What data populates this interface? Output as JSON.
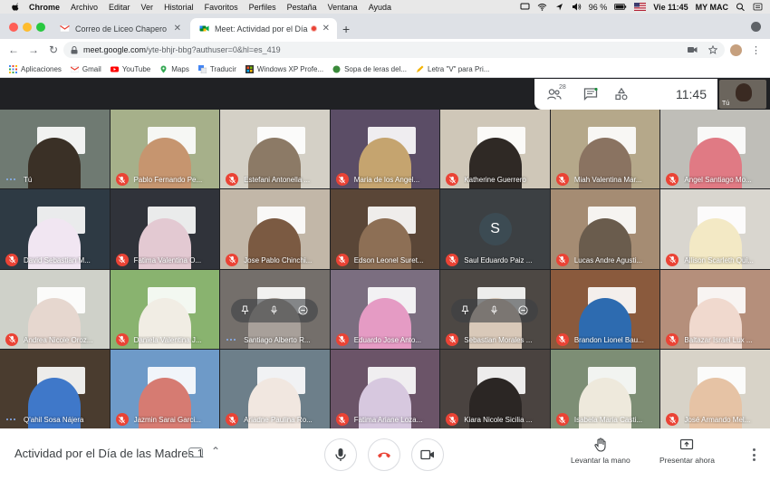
{
  "menubar": {
    "app": "Chrome",
    "items": [
      "Archivo",
      "Editar",
      "Ver",
      "Historial",
      "Favoritos",
      "Perfiles",
      "Pestaña",
      "Ventana",
      "Ayuda"
    ],
    "battery": "96 %",
    "clock": "Vie 11:45",
    "user": "MY MAC"
  },
  "tabs": [
    {
      "title": "Correo de Liceo Chapero",
      "icon": "gmail-icon",
      "active": false
    },
    {
      "title": "Meet: Actividad por el Día",
      "icon": "meet-icon",
      "active": true
    }
  ],
  "toolbar": {
    "url_host": "meet.google.com",
    "url_path": "/yte-bhjr-bbg?authuser=0&hl=es_419"
  },
  "bookmarks": [
    {
      "label": "Aplicaciones",
      "icon": "apps-grid-icon"
    },
    {
      "label": "Gmail",
      "icon": "gmail-icon"
    },
    {
      "label": "YouTube",
      "icon": "youtube-icon"
    },
    {
      "label": "Maps",
      "icon": "maps-icon"
    },
    {
      "label": "Traducir",
      "icon": "translate-icon"
    },
    {
      "label": "Windows XP Profe...",
      "icon": "windows-icon"
    },
    {
      "label": "Sopa de leras del...",
      "icon": "globe-icon"
    },
    {
      "label": "Letra \"V\" para Pri...",
      "icon": "pencil-icon"
    }
  ],
  "meet_topbar": {
    "participant_count": "28",
    "clock": "11:45",
    "self_label": "Tú"
  },
  "participants": [
    {
      "name": "Tú",
      "muted": false,
      "speaking": true,
      "colors": [
        "#6f7a72",
        "#3a3026"
      ]
    },
    {
      "name": "Pablo Fernando Pe...",
      "muted": true,
      "colors": [
        "#a6b08a",
        "#c6956f"
      ]
    },
    {
      "name": "Estefani Antonella ...",
      "muted": true,
      "colors": [
        "#d4d0c6",
        "#8c7a66"
      ]
    },
    {
      "name": "Maria de los Angel...",
      "muted": true,
      "colors": [
        "#5b4d66",
        "#c5a46f"
      ]
    },
    {
      "name": "Katherine Guerrero",
      "muted": true,
      "colors": [
        "#cfc7b8",
        "#2f2925"
      ]
    },
    {
      "name": "Miah Valentina Mar...",
      "muted": true,
      "colors": [
        "#b5a88a",
        "#8a7361"
      ]
    },
    {
      "name": "Angel Santiago Mo...",
      "muted": true,
      "colors": [
        "#bfbeb8",
        "#e07a84"
      ]
    },
    {
      "name": "David Sebastian M...",
      "muted": true,
      "colors": [
        "#2e3a44",
        "#f1e6f2"
      ]
    },
    {
      "name": "Fatima Valentina O...",
      "muted": true,
      "colors": [
        "#30333a",
        "#e3c9d2"
      ]
    },
    {
      "name": "Jose Pablo Chinchi...",
      "muted": true,
      "colors": [
        "#c2b7a8",
        "#7b5a42"
      ]
    },
    {
      "name": "Edson Leonel Suret...",
      "muted": true,
      "colors": [
        "#5a4637",
        "#8d6f55"
      ]
    },
    {
      "name": "Saul Eduardo Paiz ...",
      "muted": true,
      "colors": [
        "#3c4043",
        "#3c4043"
      ],
      "initial": "S"
    },
    {
      "name": "Lucas Andre Agusti...",
      "muted": true,
      "colors": [
        "#a58c73",
        "#6a5c4d"
      ]
    },
    {
      "name": "Allison Scarleth Qui...",
      "muted": true,
      "colors": [
        "#d9d6cf",
        "#f3e9c5"
      ]
    },
    {
      "name": "Andrea Nicole Oroz...",
      "muted": true,
      "colors": [
        "#cfd1c9",
        "#e6d7cf"
      ]
    },
    {
      "name": "Daniela Valentina J...",
      "muted": true,
      "colors": [
        "#89b36f",
        "#f1ede4"
      ]
    },
    {
      "name": "Santiago Alberto R...",
      "muted": false,
      "speaking": true,
      "colors": [
        "#746f6b",
        "#a8a09a"
      ],
      "hover": true
    },
    {
      "name": "Eduardo Jose Anto...",
      "muted": true,
      "colors": [
        "#7b6e80",
        "#e59bc4"
      ]
    },
    {
      "name": "Sebastian Morales ...",
      "muted": true,
      "colors": [
        "#4d4844",
        "#d9c9b9"
      ],
      "hover": true
    },
    {
      "name": "Brandon Lionel Bau...",
      "muted": true,
      "colors": [
        "#8a5a3d",
        "#2d6bb0"
      ]
    },
    {
      "name": "Baltazar Israel Lux ...",
      "muted": true,
      "colors": [
        "#b58f7b",
        "#f0d9ce"
      ]
    },
    {
      "name": "Q'ahil Sosa Nájera",
      "muted": false,
      "speaking": true,
      "colors": [
        "#4a3c2f",
        "#3f78c9"
      ]
    },
    {
      "name": "Jazmin Sarai Garci...",
      "muted": true,
      "colors": [
        "#6e9ac8",
        "#d67b72"
      ]
    },
    {
      "name": "Ariadne Paulina Ro...",
      "muted": true,
      "colors": [
        "#6d7f8a",
        "#f1e7e0"
      ]
    },
    {
      "name": "Fatima Ariane Loza...",
      "muted": true,
      "colors": [
        "#6b5468",
        "#d7c8df"
      ]
    },
    {
      "name": "Kiara Nicole Sicilia ...",
      "muted": true,
      "colors": [
        "#4a4340",
        "#2b2624"
      ]
    },
    {
      "name": "Isabela Maria Casti...",
      "muted": true,
      "colors": [
        "#7d8e75",
        "#eee9dc"
      ]
    },
    {
      "name": "José Armando Mel...",
      "muted": true,
      "colors": [
        "#d8d3c8",
        "#e6c3a5"
      ]
    }
  ],
  "bottombar": {
    "title": "Actividad por el Día de las Madres 1",
    "raise_hand": "Levantar la mano",
    "present": "Presentar ahora"
  },
  "colors": {
    "meet_bg": "#202124",
    "mute_red": "#ea4335",
    "hangup_red": "#ea4335"
  }
}
